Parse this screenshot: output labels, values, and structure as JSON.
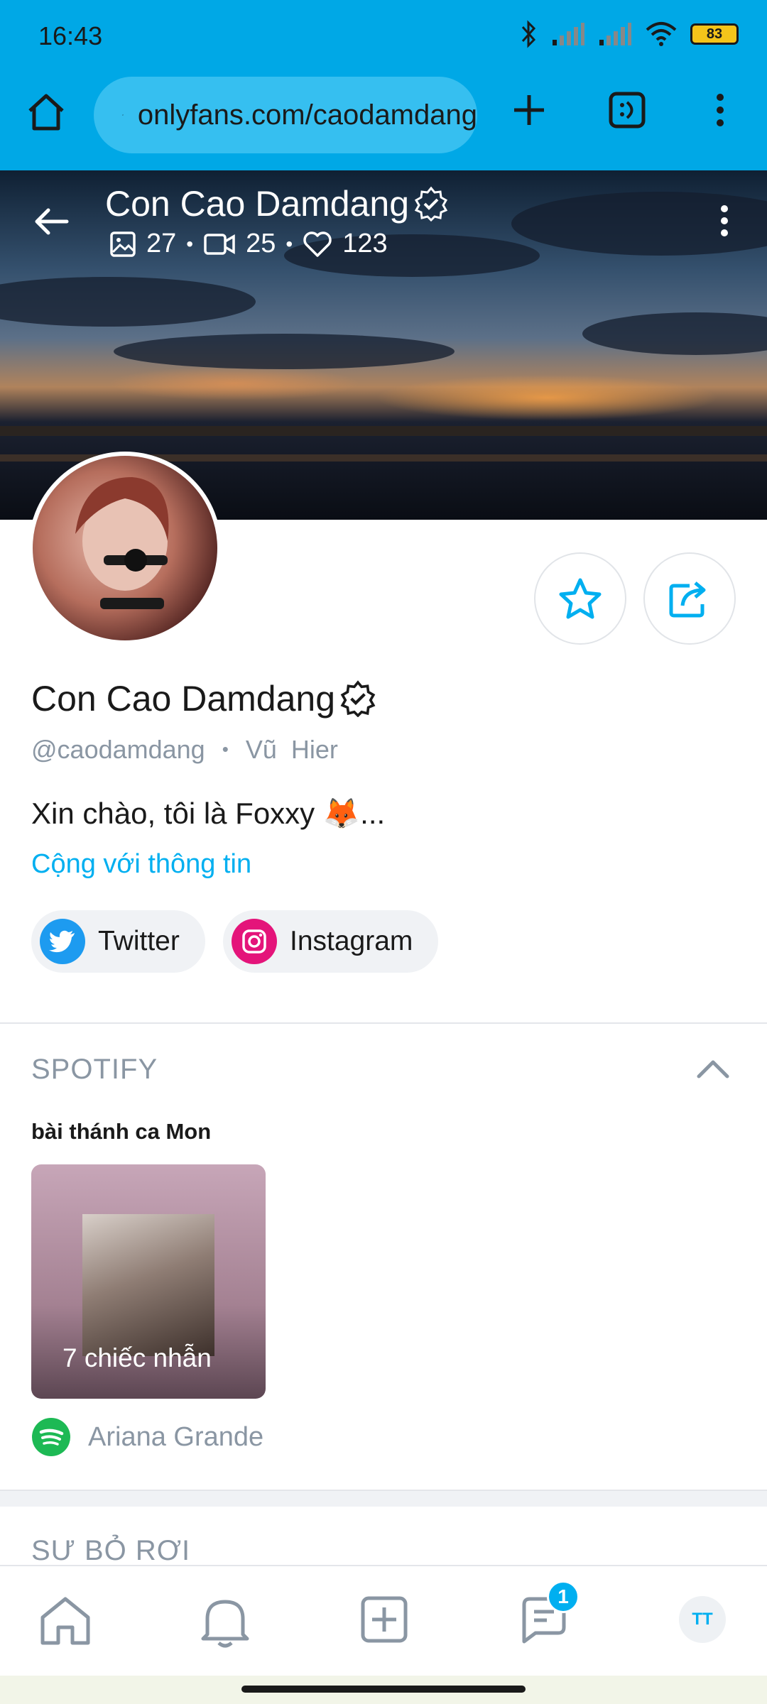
{
  "status_bar": {
    "time": "16:43",
    "battery": "83"
  },
  "browser": {
    "url": "onlyfans.com/caodamdang"
  },
  "banner": {
    "title": "Con Cao Damdang",
    "photos": "27",
    "videos": "25",
    "likes": "123"
  },
  "profile": {
    "name": "Con Cao Damdang",
    "handle": "@caodamdang",
    "separator": "•",
    "status": "Vũ  Hier",
    "bio": "Xin chào, tôi là Foxxy 🦊...",
    "more_info": "Cộng với thông tin"
  },
  "social": {
    "twitter": "Twitter",
    "instagram": "Instagram"
  },
  "spotify": {
    "section_title": "SPOTIFY",
    "playlist_title": "bài thánh ca Mon",
    "album_label": "7 chiếc nhẫn",
    "artist": "Ariana Grande"
  },
  "next_section": {
    "title": "SƯ BỎ RƠI"
  },
  "nav": {
    "messages_badge": "1",
    "user_initials": "TT"
  },
  "colors": {
    "accent": "#00aff0",
    "browser_bar": "#00a8e6",
    "muted_text": "#8a96a3",
    "spotify_green": "#1db954",
    "instagram": "#e4147a",
    "twitter": "#1d9bf0"
  }
}
